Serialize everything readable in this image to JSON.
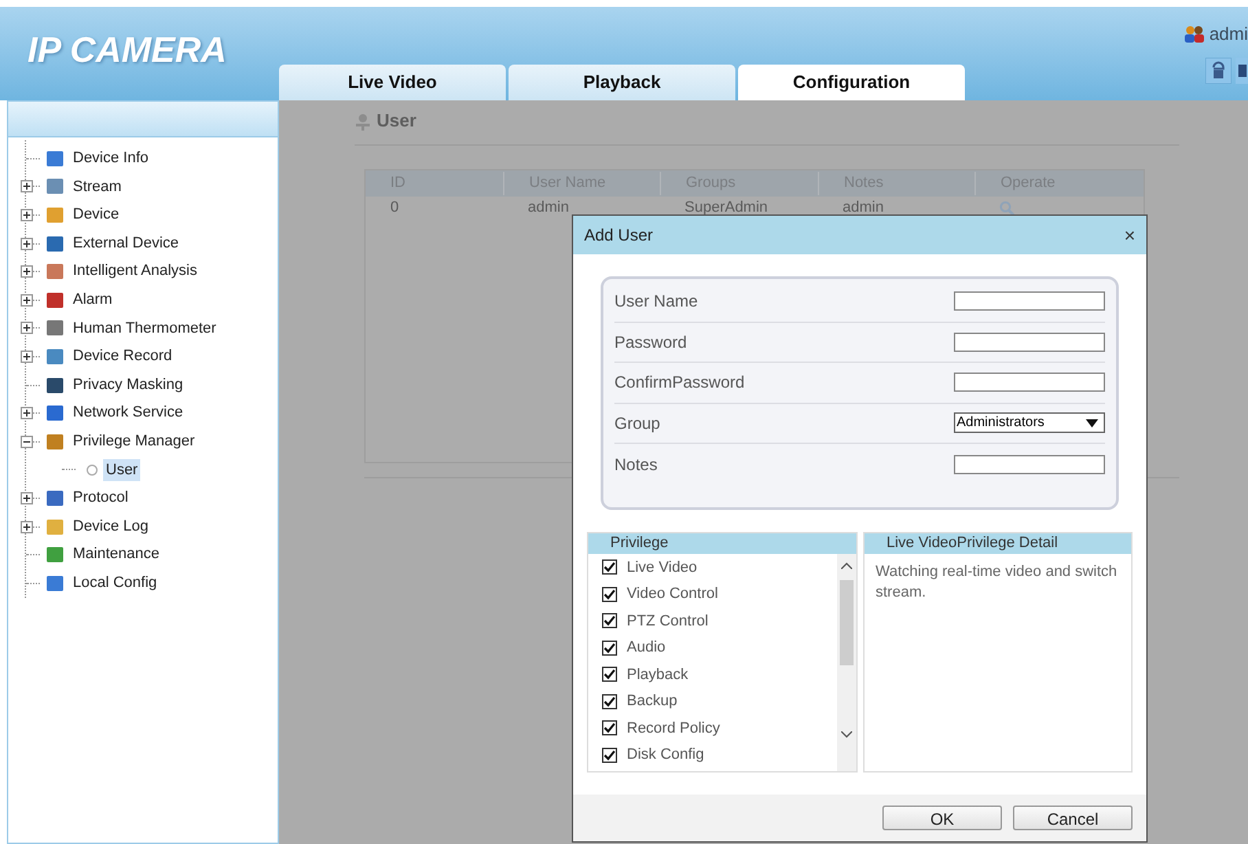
{
  "header": {
    "logo": "IP CAMERA",
    "user": "admi",
    "tabs": [
      {
        "label": "Live Video",
        "selected": false
      },
      {
        "label": "Playback",
        "selected": false
      },
      {
        "label": "Configuration",
        "selected": true
      }
    ]
  },
  "sidebar": {
    "items": [
      {
        "label": "Device Info",
        "kind": "leaf",
        "selected": false
      },
      {
        "label": "Stream",
        "kind": "group",
        "expanded": false,
        "selected": false
      },
      {
        "label": "Device",
        "kind": "group",
        "expanded": false,
        "selected": false
      },
      {
        "label": "External Device",
        "kind": "group",
        "expanded": false,
        "selected": false
      },
      {
        "label": "Intelligent Analysis",
        "kind": "group",
        "expanded": false,
        "selected": false
      },
      {
        "label": "Alarm",
        "kind": "group",
        "expanded": false,
        "selected": false
      },
      {
        "label": "Human Thermometer",
        "kind": "group",
        "expanded": false,
        "selected": false
      },
      {
        "label": "Device Record",
        "kind": "group",
        "expanded": false,
        "selected": false
      },
      {
        "label": "Privacy Masking",
        "kind": "leaf",
        "selected": false
      },
      {
        "label": "Network Service",
        "kind": "group",
        "expanded": false,
        "selected": false
      },
      {
        "label": "Privilege Manager",
        "kind": "group",
        "expanded": true,
        "selected": false,
        "children": [
          {
            "label": "User",
            "selected": true
          }
        ]
      },
      {
        "label": "Protocol",
        "kind": "group",
        "expanded": false,
        "selected": false
      },
      {
        "label": "Device Log",
        "kind": "group",
        "expanded": false,
        "selected": false
      },
      {
        "label": "Maintenance",
        "kind": "leaf",
        "selected": false
      },
      {
        "label": "Local Config",
        "kind": "leaf",
        "selected": false
      }
    ]
  },
  "page": {
    "title": "User",
    "table": {
      "columns": [
        "ID",
        "User Name",
        "Groups",
        "Notes",
        "Operate"
      ],
      "rows": [
        [
          "0",
          "admin",
          "SuperAdmin",
          "admin"
        ]
      ]
    }
  },
  "dialog": {
    "title": "Add User",
    "close": "×",
    "fields": [
      {
        "label": "User Name",
        "kind": "text"
      },
      {
        "label": "Password",
        "kind": "text"
      },
      {
        "label": "ConfirmPassword",
        "kind": "text"
      },
      {
        "label": "Group",
        "kind": "select",
        "value": "Administrators"
      },
      {
        "label": "Notes",
        "kind": "text"
      }
    ],
    "privilege": {
      "header": "Privilege",
      "items": [
        {
          "label": "Live Video",
          "checked": true
        },
        {
          "label": "Video Control",
          "checked": true
        },
        {
          "label": "PTZ Control",
          "checked": true
        },
        {
          "label": "Audio",
          "checked": true
        },
        {
          "label": "Playback",
          "checked": true
        },
        {
          "label": "Backup",
          "checked": true
        },
        {
          "label": "Record Policy",
          "checked": true
        },
        {
          "label": "Disk Config",
          "checked": true
        }
      ]
    },
    "detail": {
      "header": "Live VideoPrivilege Detail",
      "text": "Watching real-time video and switch stream."
    },
    "buttons": [
      "OK",
      "Cancel"
    ]
  }
}
